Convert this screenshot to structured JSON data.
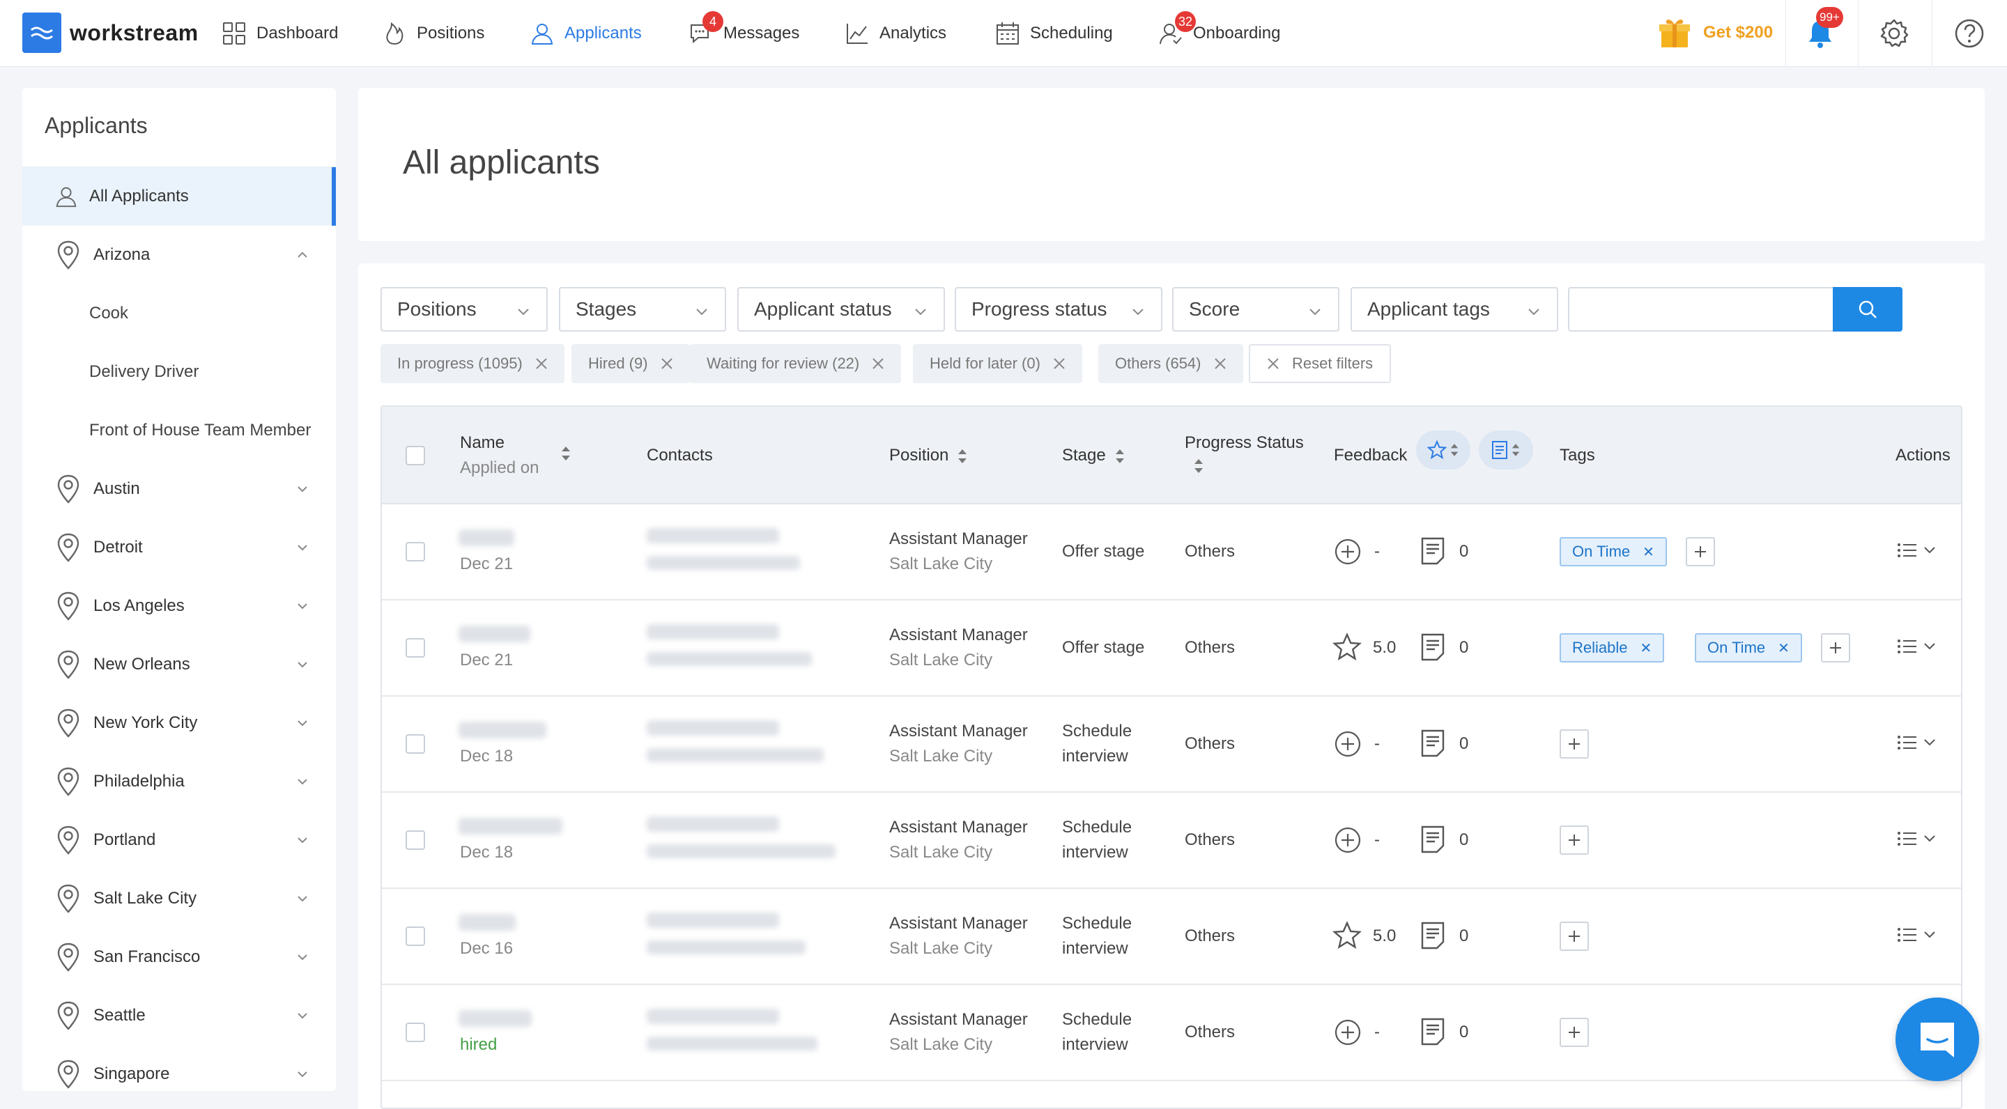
{
  "brand": {
    "name": "workstream"
  },
  "nav": {
    "dashboard": "Dashboard",
    "positions": "Positions",
    "applicants": "Applicants",
    "messages": "Messages",
    "messages_badge": "4",
    "analytics": "Analytics",
    "scheduling": "Scheduling",
    "onboarding": "Onboarding",
    "onboarding_badge": "32",
    "get_reward": "Get $200",
    "notifications_badge": "99+"
  },
  "sidebar": {
    "title": "Applicants",
    "all_applicants": "All Applicants",
    "locations": [
      {
        "label": "Arizona",
        "expanded": true,
        "children": [
          "Cook",
          "Delivery Driver",
          "Front of House Team Member"
        ]
      },
      {
        "label": "Austin"
      },
      {
        "label": "Detroit"
      },
      {
        "label": "Los Angeles"
      },
      {
        "label": "New Orleans"
      },
      {
        "label": "New York City"
      },
      {
        "label": "Philadelphia"
      },
      {
        "label": "Portland"
      },
      {
        "label": "Salt Lake City"
      },
      {
        "label": "San Francisco"
      },
      {
        "label": "Seattle"
      },
      {
        "label": "Singapore"
      }
    ]
  },
  "page": {
    "title": "All applicants"
  },
  "filters": {
    "positions": "Positions",
    "stages": "Stages",
    "applicant_status": "Applicant status",
    "progress_status": "Progress status",
    "score": "Score",
    "applicant_tags": "Applicant tags",
    "search_placeholder": ""
  },
  "chips": {
    "in_progress": "In progress (1095)",
    "hired": "Hired (9)",
    "waiting": "Waiting for review (22)",
    "held": "Held for later (0)",
    "others": "Others (654)",
    "reset": "Reset filters"
  },
  "table": {
    "headers": {
      "name": "Name",
      "applied_on": "Applied on",
      "contacts": "Contacts",
      "position": "Position",
      "stage": "Stage",
      "progress_status": "Progress Status",
      "feedback": "Feedback",
      "tags": "Tags",
      "actions": "Actions"
    },
    "rows": [
      {
        "date": "Dec 21",
        "position": "Assistant Manager",
        "location": "Salt Lake City",
        "stage": "Offer stage",
        "stage2": "",
        "status": "Others",
        "score": "-",
        "scored": false,
        "notes": "0",
        "tags": [
          "On Time"
        ]
      },
      {
        "date": "Dec 21",
        "position": "Assistant Manager",
        "location": "Salt Lake City",
        "stage": "Offer stage",
        "stage2": "",
        "status": "Others",
        "score": "5.0",
        "scored": true,
        "notes": "0",
        "tags": [
          "Reliable",
          "On Time"
        ]
      },
      {
        "date": "Dec 18",
        "position": "Assistant Manager",
        "location": "Salt Lake City",
        "stage": "Schedule",
        "stage2": "interview",
        "status": "Others",
        "score": "-",
        "scored": false,
        "notes": "0",
        "tags": []
      },
      {
        "date": "Dec 18",
        "position": "Assistant Manager",
        "location": "Salt Lake City",
        "stage": "Schedule",
        "stage2": "interview",
        "status": "Others",
        "score": "-",
        "scored": false,
        "notes": "0",
        "tags": []
      },
      {
        "date": "Dec 16",
        "position": "Assistant Manager",
        "location": "Salt Lake City",
        "stage": "Schedule",
        "stage2": "interview",
        "status": "Others",
        "score": "5.0",
        "scored": true,
        "notes": "0",
        "tags": []
      },
      {
        "date": "hired",
        "position": "Assistant Manager",
        "location": "Salt Lake City",
        "stage": "Schedule",
        "stage2": "interview",
        "status": "Others",
        "score": "-",
        "scored": false,
        "notes": "0",
        "tags": []
      }
    ]
  },
  "colors": {
    "accent": "#2c7be5",
    "badge": "#e53935",
    "reward": "#f0a020",
    "hired": "#43a047"
  }
}
